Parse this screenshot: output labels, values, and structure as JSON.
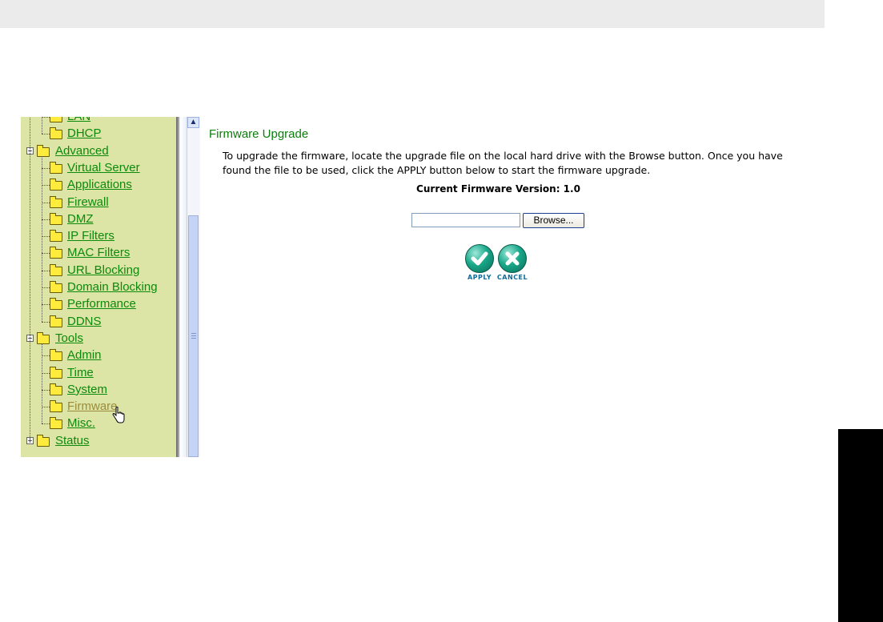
{
  "sidebar": {
    "items": [
      {
        "label": "LAN",
        "level": 1
      },
      {
        "label": "DHCP",
        "level": 1
      },
      {
        "label": "Advanced",
        "level": 0,
        "expander": "−"
      },
      {
        "label": "Virtual Server",
        "level": 1
      },
      {
        "label": "Applications",
        "level": 1
      },
      {
        "label": "Firewall",
        "level": 1
      },
      {
        "label": "DMZ",
        "level": 1
      },
      {
        "label": "IP Filters",
        "level": 1
      },
      {
        "label": "MAC Filters",
        "level": 1
      },
      {
        "label": "URL Blocking",
        "level": 1
      },
      {
        "label": "Domain Blocking",
        "level": 1
      },
      {
        "label": "Performance",
        "level": 1
      },
      {
        "label": "DDNS",
        "level": 1
      },
      {
        "label": "Tools",
        "level": 0,
        "expander": "−"
      },
      {
        "label": "Admin",
        "level": 1
      },
      {
        "label": "Time",
        "level": 1
      },
      {
        "label": "System",
        "level": 1
      },
      {
        "label": "Firmware",
        "level": 1,
        "visited": true
      },
      {
        "label": "Misc.",
        "level": 1
      },
      {
        "label": "Status",
        "level": 0,
        "expander": "+"
      }
    ]
  },
  "main": {
    "title": "Firmware Upgrade",
    "description": "To upgrade the firmware, locate the upgrade file on the local hard drive with the Browse button. Once you have found the file to be used, click the APPLY button below to start the firmware upgrade.",
    "version_text": "Current Firmware Version: 1.0",
    "file_input_value": "",
    "browse_label": "Browse...",
    "apply_label": "APPLY",
    "cancel_label": "CANCEL"
  },
  "colors": {
    "sidebar_bg": "#dde5a6",
    "link_green": "#0b8a0b",
    "title_green": "#0b7f0b",
    "visited_link": "#9a8c3c",
    "action_button_teal": "#19a889"
  },
  "icons": {
    "folder": "folder-icon",
    "apply": "checkmark-icon",
    "cancel": "x-icon",
    "cursor": "hand-pointer-icon",
    "scroll_up": "chevron-up-icon"
  }
}
